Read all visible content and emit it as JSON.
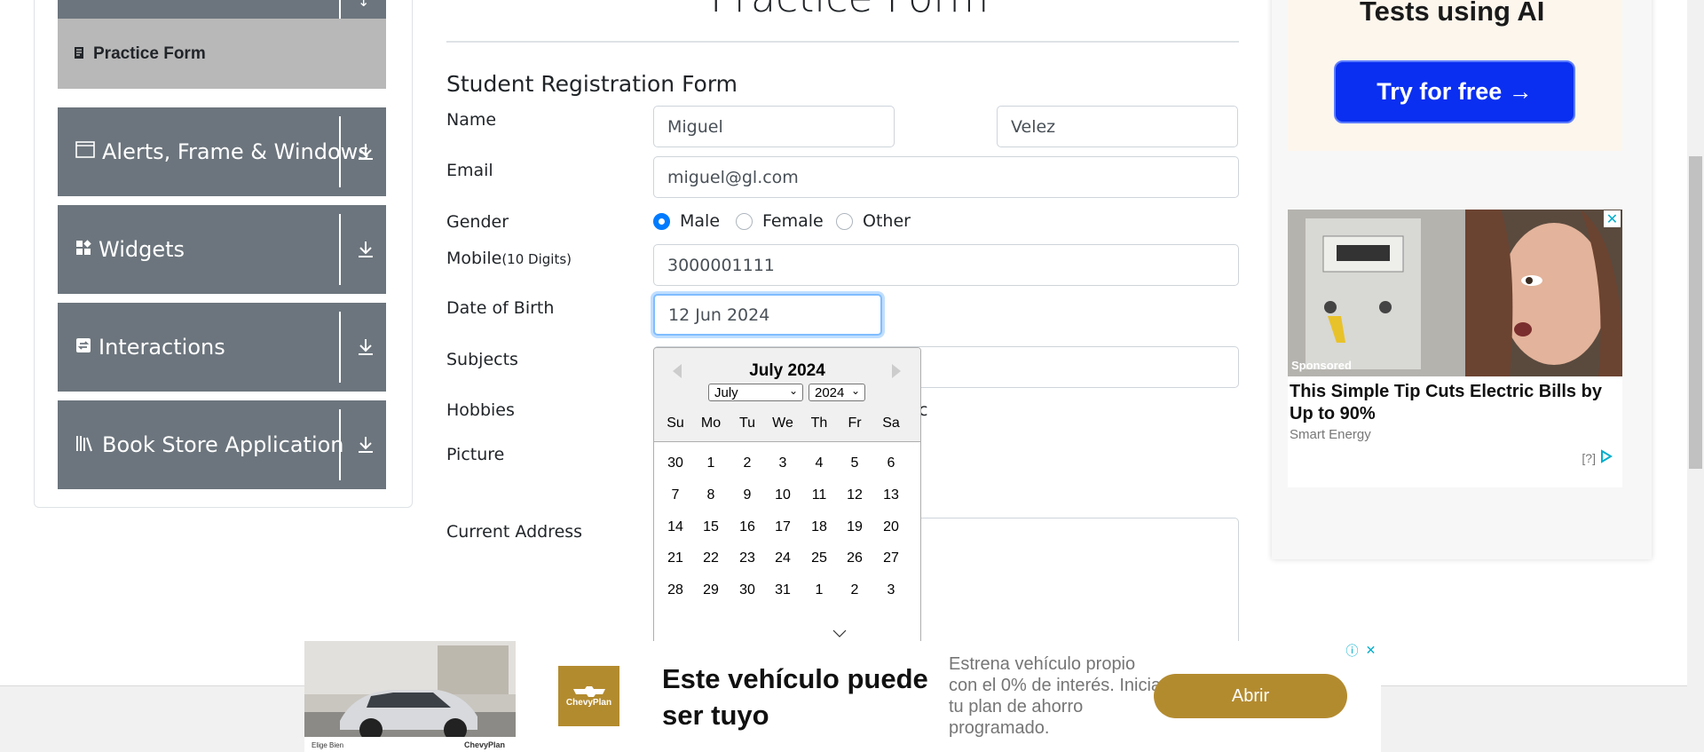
{
  "sidebar": {
    "active_item": "Practice Form",
    "groups": [
      {
        "label": "Alerts, Frame & Windows",
        "icon": "window-icon"
      },
      {
        "label": "Widgets",
        "icon": "widgets-icon"
      },
      {
        "label": "Interactions",
        "icon": "interactions-icon"
      },
      {
        "label": "Book Store Application",
        "icon": "library-icon"
      }
    ]
  },
  "page": {
    "title_fragment": "Practice Form",
    "form_title": "Student Registration Form"
  },
  "form": {
    "name_label": "Name",
    "first_name": "Miguel",
    "last_name": "Velez",
    "email_label": "Email",
    "email": "miguel@gl.com",
    "gender_label": "Gender",
    "gender_options": [
      "Male",
      "Female",
      "Other"
    ],
    "gender_selected": "Male",
    "mobile_label": "Mobile",
    "mobile_hint": "(10 Digits)",
    "mobile": "3000001111",
    "dob_label": "Date of Birth",
    "dob": "12 Jun 2024",
    "subjects_label": "Subjects",
    "hobbies_label": "Hobbies",
    "hobbies_partial": "c",
    "picture_label": "Picture",
    "address_label": "Current Address"
  },
  "datepicker": {
    "header": "July 2024",
    "month_select": "July",
    "year_select": "2024",
    "day_names": [
      "Su",
      "Mo",
      "Tu",
      "We",
      "Th",
      "Fr",
      "Sa"
    ],
    "weeks": [
      [
        "30",
        "1",
        "2",
        "3",
        "4",
        "5",
        "6"
      ],
      [
        "7",
        "8",
        "9",
        "10",
        "11",
        "12",
        "13"
      ],
      [
        "14",
        "15",
        "16",
        "17",
        "18",
        "19",
        "20"
      ],
      [
        "21",
        "22",
        "23",
        "24",
        "25",
        "26",
        "27"
      ],
      [
        "28",
        "29",
        "30",
        "31",
        "1",
        "2",
        "3"
      ]
    ]
  },
  "right_ad": {
    "headline": "Tests using AI",
    "button": "Try for free →",
    "card_title": "This Simple Tip Cuts Electric Bills by Up to 90%",
    "card_source": "Smart Energy",
    "sponsored": "Sponsored",
    "info": "[?]"
  },
  "bottom_ad": {
    "headline": "Este vehículo puede ser tuyo",
    "description": "Estrena vehículo propio con el 0% de interés. Inicia tu plan de ahorro programado.",
    "button": "Abrir",
    "logo_text": "ChevyPlan"
  }
}
